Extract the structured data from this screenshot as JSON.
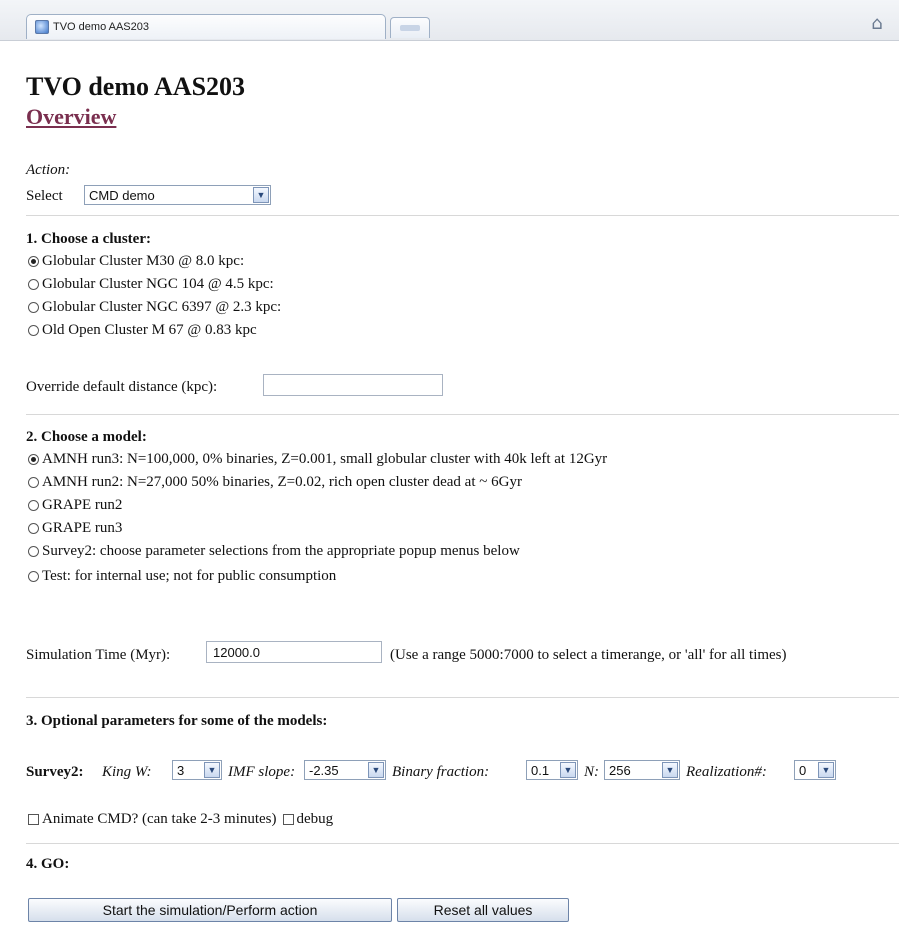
{
  "browser": {
    "tab_title": "TVO demo AAS203"
  },
  "page": {
    "title": "TVO demo AAS203",
    "overview_link": "Overview"
  },
  "action": {
    "label": "Action:",
    "select_label": "Select",
    "selected": "CMD demo"
  },
  "section1": {
    "heading": "1. Choose a cluster:",
    "options": [
      {
        "label": "Globular Cluster M30 @ 8.0 kpc:",
        "checked": true
      },
      {
        "label": "Globular Cluster NGC 104 @ 4.5 kpc:",
        "checked": false
      },
      {
        "label": "Globular Cluster NGC 6397 @ 2.3 kpc:",
        "checked": false
      },
      {
        "label": "Old Open Cluster M 67 @ 0.83 kpc",
        "checked": false
      }
    ],
    "override_label": "Override default distance (kpc):",
    "override_value": ""
  },
  "section2": {
    "heading": "2. Choose a model:",
    "options": [
      {
        "label": "AMNH run3: N=100,000, 0% binaries, Z=0.001, small globular cluster with 40k left at 12Gyr",
        "checked": true
      },
      {
        "label": "AMNH run2: N=27,000 50% binaries, Z=0.02, rich open cluster dead at ~ 6Gyr",
        "checked": false
      },
      {
        "label": "GRAPE run2",
        "checked": false
      },
      {
        "label": "GRAPE run3",
        "checked": false
      },
      {
        "label": "Survey2: choose parameter selections from the appropriate popup menus below",
        "checked": false
      },
      {
        "label": "Test: for internal use; not for public consumption",
        "checked": false
      }
    ],
    "sim_time_label": "Simulation Time (Myr):",
    "sim_time_value": "12000.0",
    "sim_time_hint": "(Use a range 5000:7000 to select a timerange, or 'all' for all times)"
  },
  "section3": {
    "heading": "3. Optional parameters for some of the models:",
    "survey_label": "Survey2:",
    "king_label": "King W:",
    "king_value": "3",
    "imf_label": "IMF slope:",
    "imf_value": "-2.35",
    "binary_label": "Binary fraction:",
    "binary_value": "0.1",
    "n_label": "N:",
    "n_value": "256",
    "realization_label": "Realization#:",
    "realization_value": "0",
    "animate_label": "Animate CMD? (can take 2-3 minutes)",
    "debug_label": "debug"
  },
  "section4": {
    "heading": "4. GO:",
    "start_button": "Start the simulation/Perform action",
    "reset_button": "Reset all values"
  }
}
